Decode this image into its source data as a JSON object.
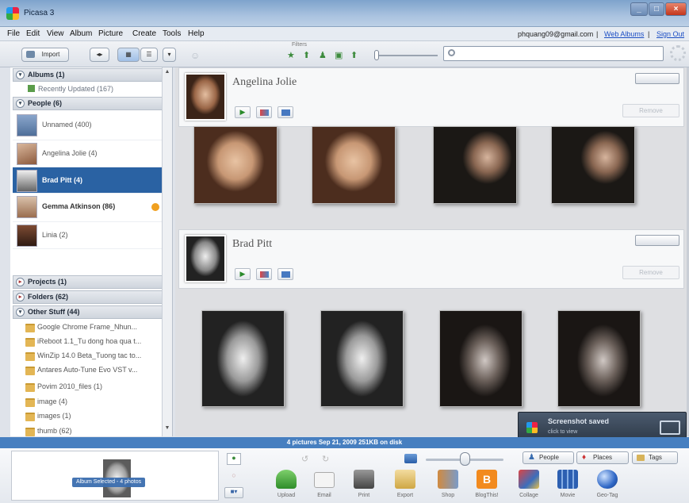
{
  "window": {
    "title": "Picasa 3"
  },
  "menu": {
    "items": [
      "File",
      "Edit",
      "View",
      "Album",
      "Picture",
      "Create",
      "Tools",
      "Help"
    ],
    "account": "phquang09@gmail.com",
    "web_albums": "Web Albums",
    "sign_out": "Sign Out",
    "sep": "|"
  },
  "toolbar": {
    "import_label": "Import",
    "filters_label": "Filters"
  },
  "sidebar": {
    "albums": {
      "label": "Albums (1)",
      "items": [
        "Recently Updated (167)"
      ]
    },
    "people": {
      "label": "People (6)",
      "items": [
        {
          "name": "Unnamed (400)",
          "selected": false
        },
        {
          "name": "Angelina Jolie (4)",
          "selected": false
        },
        {
          "name": "Brad Pitt (4)",
          "selected": true
        },
        {
          "name": "Gemma Atkinson (86)",
          "selected": false
        },
        {
          "name": "Linia (2)",
          "selected": false
        }
      ]
    },
    "projects": {
      "label": "Projects (1)"
    },
    "folders": {
      "label": "Folders (62)"
    },
    "other": {
      "label": "Other Stuff (44)",
      "items": [
        "Google Chrome Frame_Nhun...",
        "iReboot 1.1_Tu dong hoa qua t...",
        "WinZip 14.0 Beta_Tuong tac to...",
        "Antares Auto-Tune Evo VST v...",
        "Povim 2010_files (1)",
        "image (4)",
        "images (1)",
        "thumb (62)"
      ]
    }
  },
  "main": {
    "groups": [
      {
        "name": "Angelina Jolie",
        "remove_label": "Remove"
      },
      {
        "name": "Brad Pitt",
        "remove_label": "Remove"
      }
    ]
  },
  "toast": {
    "title": "Screenshot saved",
    "sub": "click to view"
  },
  "status": {
    "text": "4 pictures   Sep 21, 2009   251KB on disk"
  },
  "tray": {
    "selected_label": "Album Selected - 4 photos"
  },
  "actions": [
    "Upload",
    "Email",
    "Print",
    "Export",
    "Shop",
    "BlogThis!",
    "Collage",
    "Movie",
    "Geo-Tag"
  ],
  "tags": {
    "people": "People",
    "places": "Places",
    "tags": "Tags"
  },
  "colors": {
    "selection": "#2a62a3",
    "status_bar": "#477fc0"
  }
}
